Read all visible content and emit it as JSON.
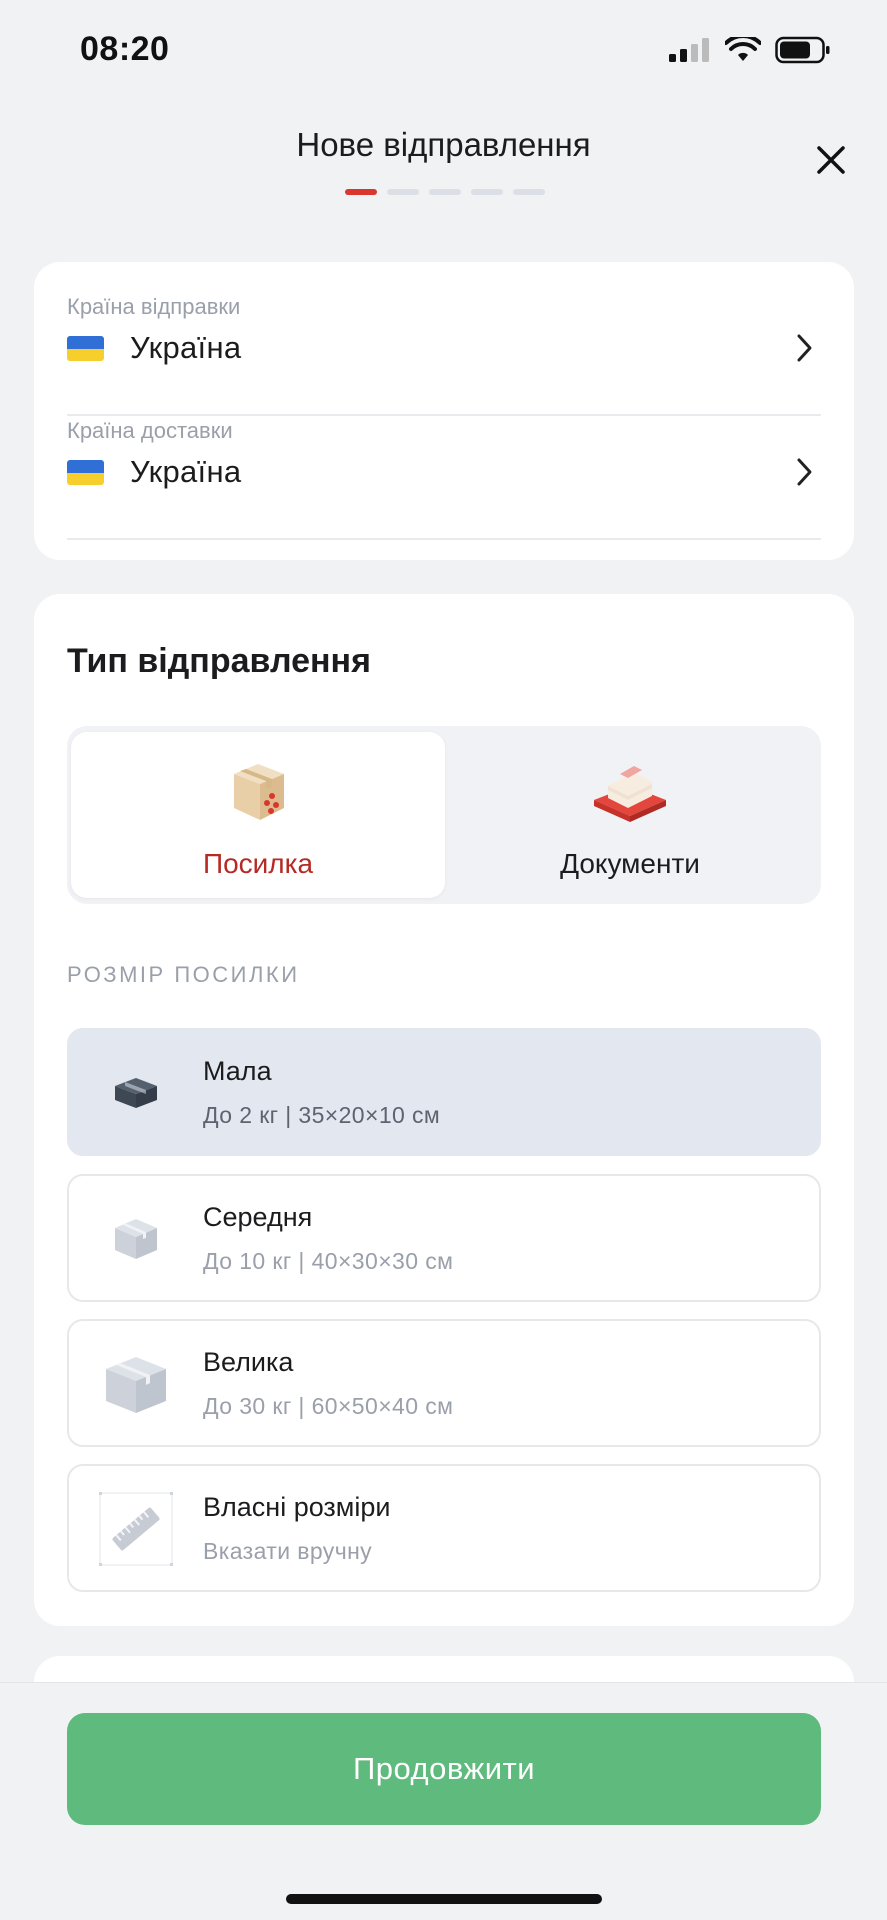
{
  "status_bar": {
    "time": "08:20"
  },
  "header": {
    "title": "Нове відправлення",
    "steps_total": 5,
    "step_current": 1
  },
  "route": {
    "from_label": "Країна відправки",
    "from_value": "Україна",
    "to_label": "Країна доставки",
    "to_value": "Україна"
  },
  "shipment_type": {
    "title": "Тип відправлення",
    "options": [
      {
        "label": "Посилка",
        "selected": true
      },
      {
        "label": "Документи",
        "selected": false
      }
    ]
  },
  "parcel_size": {
    "heading": "РОЗМІР ПОСИЛКИ",
    "options": [
      {
        "name": "Мала",
        "desc": "До 2 кг | 35×20×10 см",
        "selected": true
      },
      {
        "name": "Середня",
        "desc": "До 10 кг | 40×30×30 см",
        "selected": false
      },
      {
        "name": "Велика",
        "desc": "До 30 кг | 60×50×40 см",
        "selected": false
      },
      {
        "name": "Власні розміри",
        "desc": "Вказати вручну",
        "selected": false
      }
    ]
  },
  "actions": {
    "continue_label": "Продовжити"
  },
  "colors": {
    "accent_red": "#d9372d",
    "primary_green": "#5fba7d",
    "selected_bg": "#e3e7ef"
  }
}
